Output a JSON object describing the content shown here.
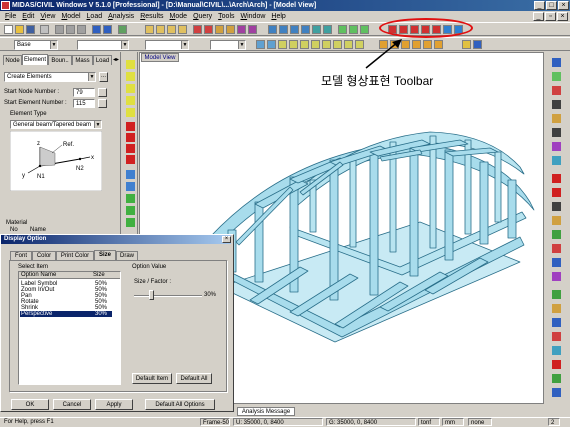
{
  "window": {
    "title": "MIDAS/CIVIL Windows V 5.1.0 [Professional] - [D:\\Manual\\CIVIL\\...\\Arch\\Arch] - [Model View]"
  },
  "menu": [
    "File",
    "Edit",
    "View",
    "Model",
    "Load",
    "Analysis",
    "Results",
    "Mode",
    "Query",
    "Tools",
    "Window",
    "Help"
  ],
  "toolbar": {
    "base_label": "Base"
  },
  "annotation": {
    "text": "모델 형상표현 Toolbar"
  },
  "panel": {
    "tabs": [
      "Node",
      "Element",
      "Boun..",
      "Mass",
      "Load"
    ],
    "mode": "Create Elements",
    "start_node_label": "Start Node Number :",
    "start_node_value": "79",
    "start_element_label": "Start Element Number :",
    "start_element_value": "115",
    "element_type_label": "Element Type",
    "element_type_value": "General beam/Tapered beam",
    "diagram": {
      "ref": "Ref.",
      "x": "x",
      "y": "y",
      "z": "z",
      "n1": "N1",
      "n2": "N2"
    },
    "material_label": "Material",
    "no_label": "No",
    "name_label": "Name"
  },
  "model_view": {
    "tab": "Model View"
  },
  "dialog": {
    "title": "Display Option",
    "tabs": [
      "Font",
      "Color",
      "Print Color",
      "Size",
      "Draw"
    ],
    "active_tab": "Size",
    "select_item_label": "Select Item",
    "columns": {
      "name": "Option Name",
      "size": "Size"
    },
    "rows": [
      {
        "name": "Label Symbol",
        "size": "50%"
      },
      {
        "name": "Zoom In/Out",
        "size": "50%"
      },
      {
        "name": "Pan",
        "size": "50%"
      },
      {
        "name": "Rotate",
        "size": "50%"
      },
      {
        "name": "Shrink",
        "size": "50%"
      },
      {
        "name": "Perspective",
        "size": "30%"
      }
    ],
    "option_value_label": "Option Value",
    "size_factor_label": "Size / Factor :",
    "size_factor_value": "30%",
    "default_item": "Default Item",
    "default_all": "Default All",
    "ok": "OK",
    "cancel": "Cancel",
    "apply": "Apply",
    "default_all_options": "Default All Options"
  },
  "status": {
    "help": "For Help, press F1",
    "frame": "Frame-50",
    "u_coord": "U: 35000, 0, 8400",
    "g_coord": "G: 35000, 0, 8400",
    "unit_force": "tonf",
    "unit_length": "mm",
    "snap": "none",
    "page": "2",
    "analysis_message_tab": "Analysis Message"
  },
  "colors": {
    "model_fill": "#a8dcec",
    "model_stroke": "#2a6f8a",
    "highlight": "#e01010",
    "titlebar": "#0a246a"
  }
}
